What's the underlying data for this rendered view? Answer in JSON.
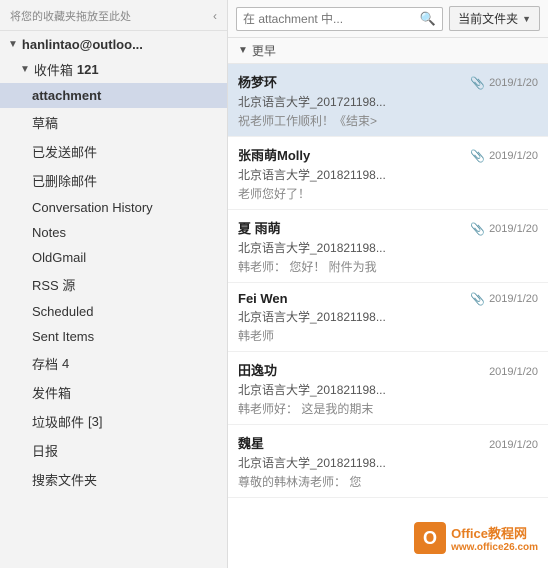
{
  "sidebar": {
    "drag_hint": "将您的收藏夹拖放至此处",
    "account": "hanlintao@outloo...",
    "inbox_label": "收件箱",
    "inbox_badge": "121",
    "active_folder": "attachment",
    "folders": [
      {
        "id": "attachment",
        "label": "attachment",
        "badge": ""
      },
      {
        "id": "draft",
        "label": "草稿",
        "badge": ""
      },
      {
        "id": "sent",
        "label": "已发送邮件",
        "badge": ""
      },
      {
        "id": "deleted",
        "label": "已删除邮件",
        "badge": ""
      },
      {
        "id": "conversation",
        "label": "Conversation History",
        "badge": ""
      },
      {
        "id": "notes",
        "label": "Notes",
        "badge": ""
      },
      {
        "id": "oldgmail",
        "label": "OldGmail",
        "badge": ""
      },
      {
        "id": "rss",
        "label": "RSS 源",
        "badge": ""
      },
      {
        "id": "scheduled",
        "label": "Scheduled",
        "badge": ""
      },
      {
        "id": "sentitems",
        "label": "Sent Items",
        "badge": ""
      },
      {
        "id": "archive",
        "label": "存档",
        "badge": "4"
      },
      {
        "id": "outbox",
        "label": "发件箱",
        "badge": ""
      },
      {
        "id": "junk",
        "label": "垃圾邮件",
        "badge": "[3]"
      },
      {
        "id": "daily",
        "label": "日报",
        "badge": ""
      },
      {
        "id": "search",
        "label": "搜索文件夹",
        "badge": ""
      }
    ]
  },
  "search": {
    "placeholder": "在 attachment 中...",
    "scope_label": "当前文件夹"
  },
  "email_list": {
    "section_label": "更早",
    "emails": [
      {
        "sender": "杨梦环",
        "subject": "北京语言大学_201721198...",
        "preview": "祝老师工作顺利！《结束>",
        "date": "2019/1/20",
        "has_attachment": true,
        "selected": true
      },
      {
        "sender": "张雨萌Molly",
        "subject": "北京语言大学_201821198...",
        "preview": "老师您好了！",
        "date": "2019/1/20",
        "has_attachment": true,
        "selected": false
      },
      {
        "sender": "夏 雨萌",
        "subject": "北京语言大学_201821198...",
        "preview": "韩老师：  您好！  附件为我",
        "date": "2019/1/20",
        "has_attachment": true,
        "selected": false
      },
      {
        "sender": "Fei Wen",
        "subject": "北京语言大学_201821198...",
        "preview": "韩老师",
        "date": "2019/1/20",
        "has_attachment": true,
        "selected": false
      },
      {
        "sender": "田逸功",
        "subject": "北京语言大学_201821198...",
        "preview": "韩老师好：  这是我的期末",
        "date": "2019/1/20",
        "has_attachment": false,
        "selected": false
      },
      {
        "sender": "魏星",
        "subject": "北京语言大学_201821198...",
        "preview": "尊敬的韩林涛老师：  您",
        "date": "2019/1/20",
        "has_attachment": false,
        "selected": false
      }
    ]
  },
  "brand": {
    "name": "Office教程网",
    "url": "www.office26.com"
  }
}
